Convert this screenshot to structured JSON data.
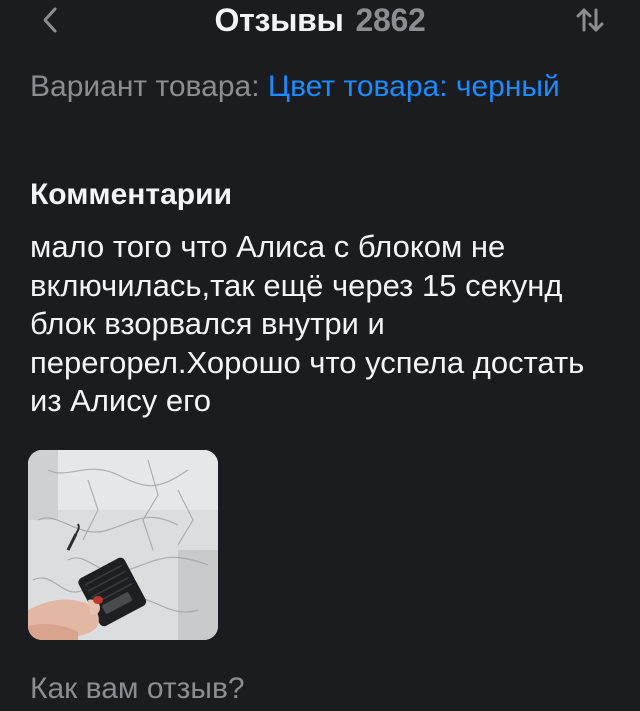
{
  "header": {
    "title": "Отзывы",
    "count": "2862"
  },
  "variant": {
    "label": "Вариант товара: ",
    "value": "Цвет товара: черный"
  },
  "comments": {
    "heading": "Комментарии",
    "text": "мало того что Алиса с блоком не включилась,так ещё через 15 секунд блок взорвался внутри и перегорел.Хорошо что успела достать из Алису его"
  },
  "rate_prompt": "Как вам отзыв?",
  "colors": {
    "background": "#1b1c20",
    "accent": "#1a8cff",
    "muted": "#8b8d93"
  },
  "icons": {
    "back": "chevron-left-icon",
    "sort": "sort-arrows-icon"
  }
}
